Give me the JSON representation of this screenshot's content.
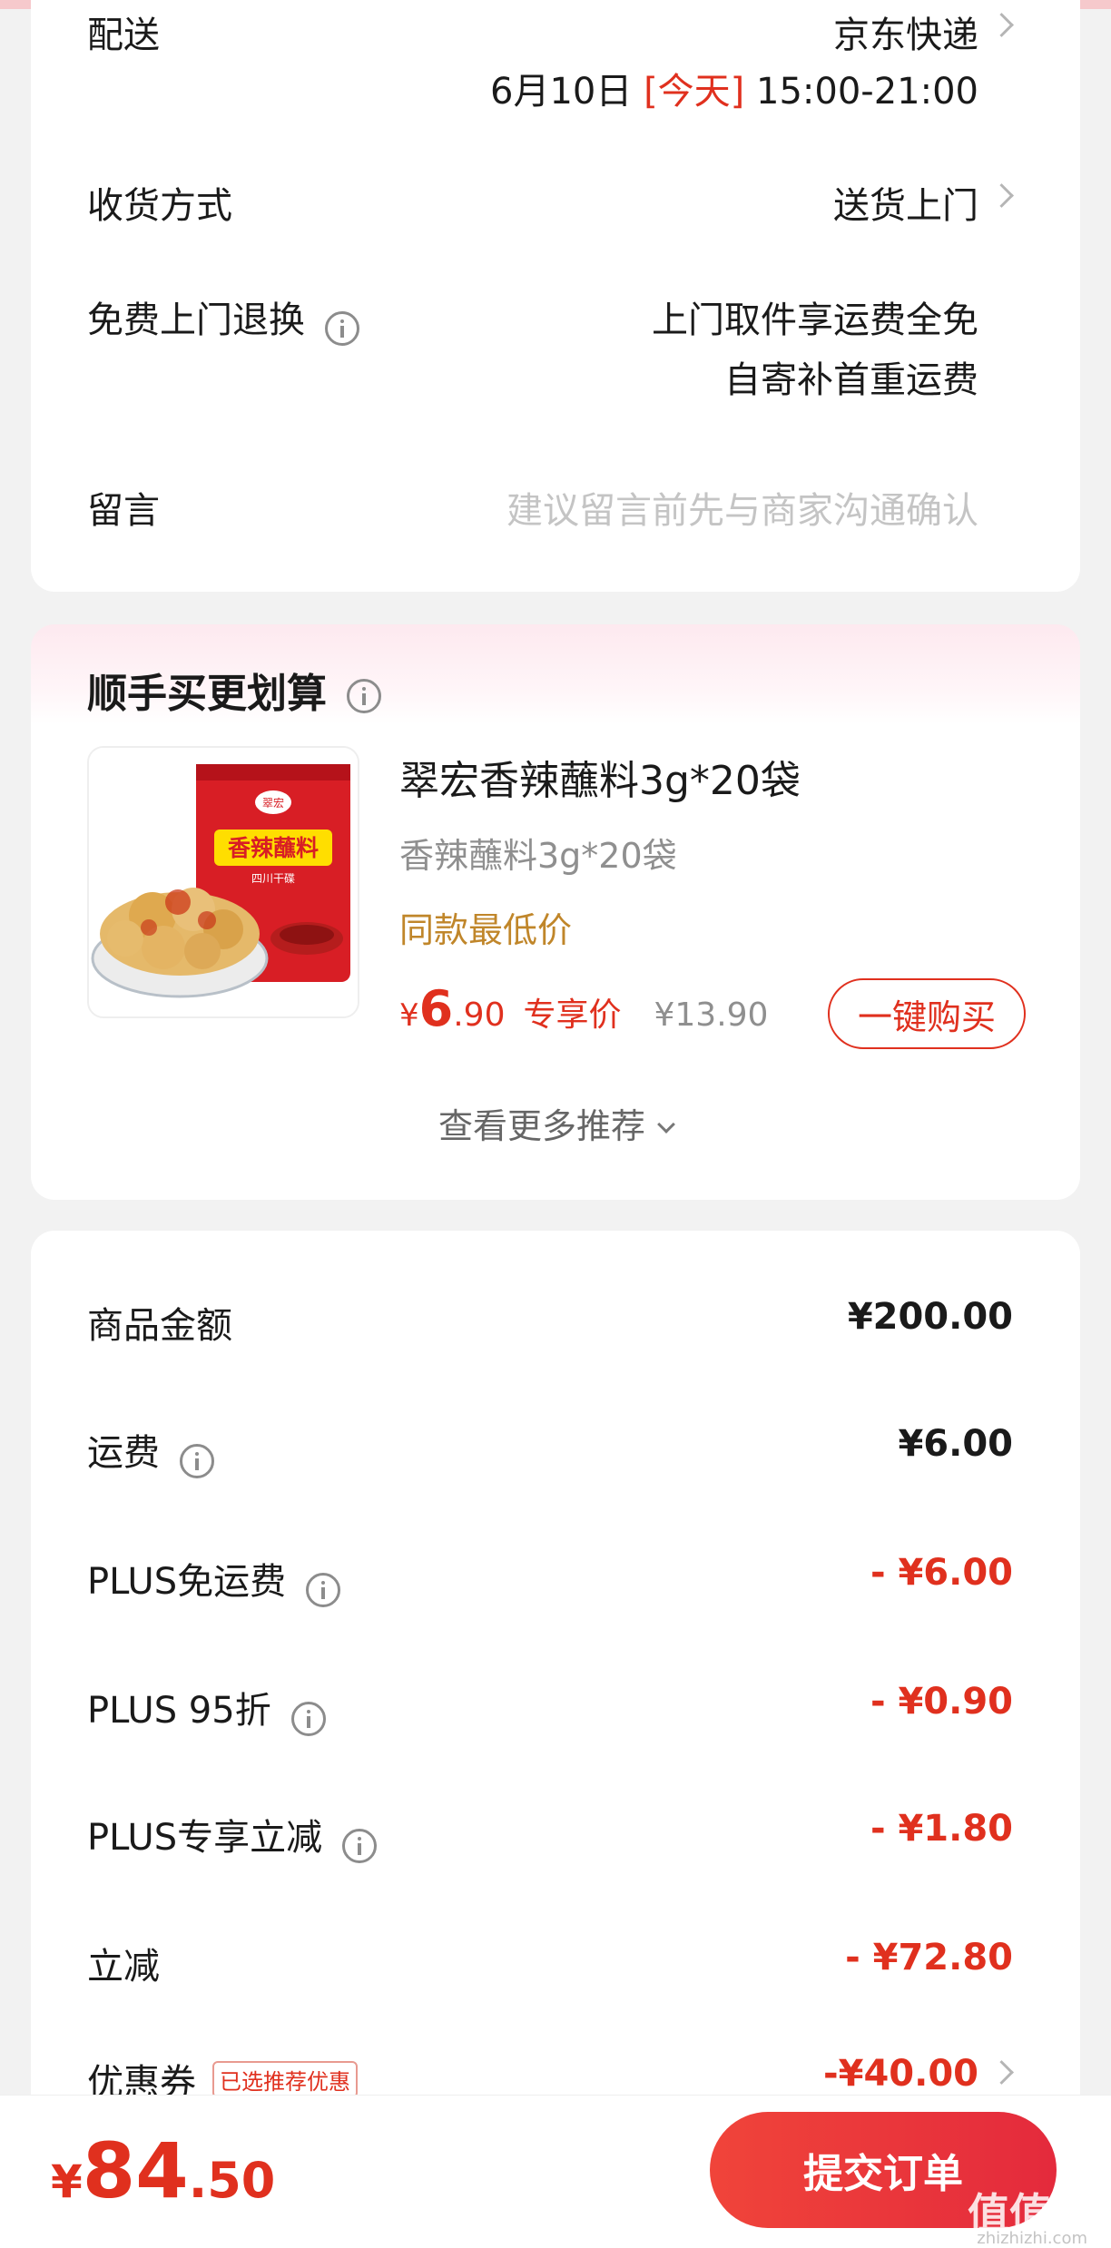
{
  "delivery": {
    "label": "配送",
    "carrier": "京东快递",
    "date": "6月10日",
    "today": "[今天]",
    "time": "15:00-21:00"
  },
  "receive": {
    "label": "收货方式",
    "value": "送货上门"
  },
  "free_return": {
    "label": "免费上门退换",
    "line1": "上门取件享运费全免",
    "line2": "自寄补首重运费"
  },
  "message": {
    "label": "留言",
    "placeholder": "建议留言前先与商家沟通确认"
  },
  "recommend": {
    "title": "顺手买更划算",
    "product": {
      "name": "翠宏香辣蘸料3g*20袋",
      "spec": "香辣蘸料3g*20袋",
      "tag": "同款最低价",
      "price_currency": "¥",
      "price_int": "6",
      "price_dec": ".90",
      "exclusive": "专享价",
      "original": "¥13.90",
      "buy_label": "一键购买",
      "package_brand": "翠宏",
      "package_title": "香辣蘸料",
      "package_sub": "四川干碟"
    },
    "more_label": "查看更多推荐"
  },
  "summary": {
    "rows": [
      {
        "label": "商品金额",
        "value": "¥200.00"
      },
      {
        "label": "运费",
        "value": "¥6.00"
      },
      {
        "label": "PLUS免运费",
        "value": "- ¥6.00"
      },
      {
        "label": "PLUS 95折",
        "value": "- ¥0.90"
      },
      {
        "label": "PLUS专享立减",
        "value": "- ¥1.80"
      },
      {
        "label": "立减",
        "value": "- ¥72.80"
      },
      {
        "label": "优惠券",
        "badge": "已选推荐优惠",
        "value": "-¥40.00"
      }
    ]
  },
  "bottom": {
    "currency": "¥",
    "total_int": "84",
    "total_dec": ".50",
    "submit_label": "提交订单",
    "watermark": "值值值",
    "watermark_sub": "zhizhizhi.com"
  },
  "colors": {
    "accent": "#e0301e",
    "gold": "#c0862a",
    "muted": "#8f8f8f"
  }
}
